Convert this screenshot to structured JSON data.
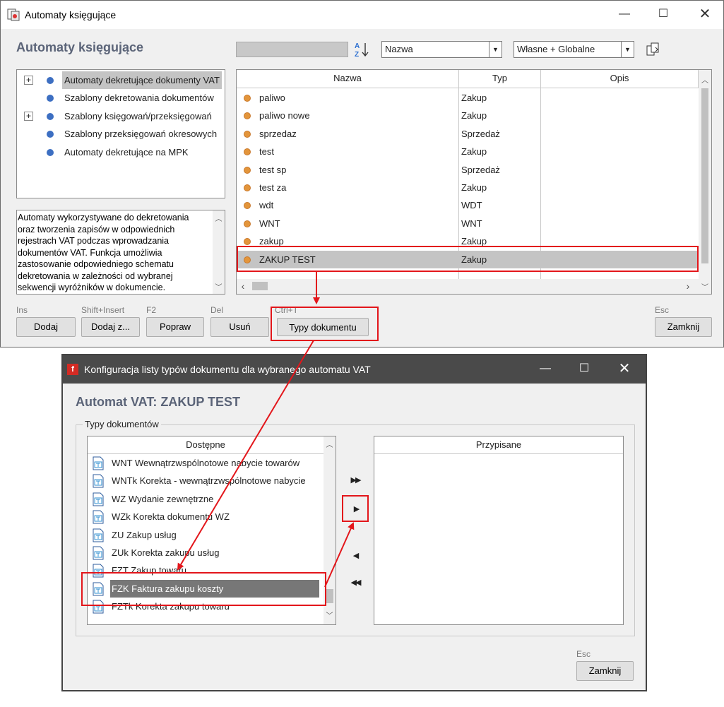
{
  "main_window": {
    "title": "Automaty księgujące",
    "heading": "Automaty księgujące",
    "sort_combo": "Nazwa",
    "scope_combo": "Własne + Globalne",
    "tree": [
      {
        "label": "Automaty dekretujące dokumenty VAT",
        "expandable": true,
        "selected": true
      },
      {
        "label": "Szablony dekretowania dokumentów",
        "expandable": false,
        "selected": false
      },
      {
        "label": "Szablony księgowań/przeksięgowań",
        "expandable": true,
        "selected": false
      },
      {
        "label": "Szablony przeksięgowań okresowych",
        "expandable": false,
        "selected": false
      },
      {
        "label": "Automaty dekretujące na MPK",
        "expandable": false,
        "selected": false
      }
    ],
    "description": "Automaty wykorzystywane do dekretowania oraz tworzenia zapisów w odpowiednich rejestrach VAT podczas wprowadzania dokumentów VAT. Funkcja umożliwia zastosowanie odpowiedniego schematu dekretowania w zależności od wybranej sekwencji wyróżników w dokumencie.",
    "table": {
      "columns": [
        "Nazwa",
        "Typ",
        "Opis"
      ],
      "rows": [
        {
          "name": "paliwo",
          "type": "Zakup",
          "desc": ""
        },
        {
          "name": "paliwo nowe",
          "type": "Zakup",
          "desc": ""
        },
        {
          "name": "sprzedaz",
          "type": "Sprzedaż",
          "desc": ""
        },
        {
          "name": "test",
          "type": "Zakup",
          "desc": ""
        },
        {
          "name": "test sp",
          "type": "Sprzedaż",
          "desc": ""
        },
        {
          "name": "test za",
          "type": "Zakup",
          "desc": ""
        },
        {
          "name": "wdt",
          "type": "WDT",
          "desc": ""
        },
        {
          "name": "WNT",
          "type": "WNT",
          "desc": ""
        },
        {
          "name": "zakup",
          "type": "Zakup",
          "desc": ""
        },
        {
          "name": "ZAKUP TEST",
          "type": "Zakup",
          "desc": ""
        }
      ],
      "selected_index": 9
    },
    "buttons": [
      {
        "hint": "Ins",
        "label": "Dodaj"
      },
      {
        "hint": "Shift+Insert",
        "label": "Dodaj z..."
      },
      {
        "hint": "F2",
        "label": "Popraw"
      },
      {
        "hint": "Del",
        "label": "Usuń"
      },
      {
        "hint": "Ctrl+T",
        "label": "Typy dokumentu"
      }
    ],
    "close_hint": "Esc",
    "close_label": "Zamknij"
  },
  "dialog": {
    "title": "Konfiguracja listy typów dokumentu dla wybranego automatu VAT",
    "heading": "Automat VAT: ZAKUP TEST",
    "group_label": "Typy dokumentów",
    "available_header": "Dostępne",
    "assigned_header": "Przypisane",
    "available_items": [
      "WNT Wewnątrzwspólnotowe nabycie towarów",
      "WNTk Korekta - wewnątrzwspólnotowe nabycie",
      "WZ Wydanie zewnętrzne",
      "WZk Korekta dokumentu WZ",
      "ZU Zakup usług",
      "ZUk Korekta zakupu usług",
      "FZT Zakup towaru",
      "FZK Faktura zakupu koszty",
      "FZTk Korekta zakupu towaru"
    ],
    "selected_available_index": 7,
    "assigned_items": [],
    "move_buttons": [
      "add-all",
      "add",
      "remove",
      "remove-all"
    ],
    "close_hint": "Esc",
    "close_label": "Zamknij"
  },
  "colors": {
    "highlight_red": "#e3161b",
    "selection_gray": "#c4c4c4",
    "selection_dark": "#777777",
    "heading_color": "#5b6478",
    "dot_orange": "#e3953b",
    "dot_blue": "#3d6fc2"
  }
}
